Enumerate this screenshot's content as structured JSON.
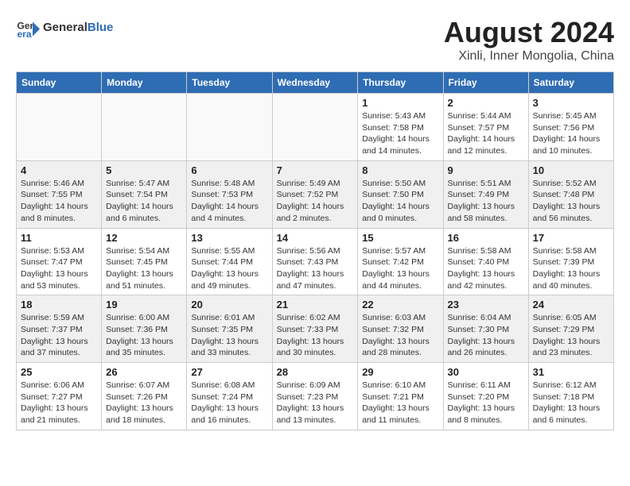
{
  "header": {
    "logo_general": "General",
    "logo_blue": "Blue",
    "month_year": "August 2024",
    "location": "Xinli, Inner Mongolia, China"
  },
  "calendar": {
    "days_of_week": [
      "Sunday",
      "Monday",
      "Tuesday",
      "Wednesday",
      "Thursday",
      "Friday",
      "Saturday"
    ],
    "weeks": [
      {
        "shaded": false,
        "days": [
          {
            "num": "",
            "sunrise": "",
            "sunset": "",
            "daylight": ""
          },
          {
            "num": "",
            "sunrise": "",
            "sunset": "",
            "daylight": ""
          },
          {
            "num": "",
            "sunrise": "",
            "sunset": "",
            "daylight": ""
          },
          {
            "num": "",
            "sunrise": "",
            "sunset": "",
            "daylight": ""
          },
          {
            "num": "1",
            "sunrise": "Sunrise: 5:43 AM",
            "sunset": "Sunset: 7:58 PM",
            "daylight": "Daylight: 14 hours and 14 minutes."
          },
          {
            "num": "2",
            "sunrise": "Sunrise: 5:44 AM",
            "sunset": "Sunset: 7:57 PM",
            "daylight": "Daylight: 14 hours and 12 minutes."
          },
          {
            "num": "3",
            "sunrise": "Sunrise: 5:45 AM",
            "sunset": "Sunset: 7:56 PM",
            "daylight": "Daylight: 14 hours and 10 minutes."
          }
        ]
      },
      {
        "shaded": true,
        "days": [
          {
            "num": "4",
            "sunrise": "Sunrise: 5:46 AM",
            "sunset": "Sunset: 7:55 PM",
            "daylight": "Daylight: 14 hours and 8 minutes."
          },
          {
            "num": "5",
            "sunrise": "Sunrise: 5:47 AM",
            "sunset": "Sunset: 7:54 PM",
            "daylight": "Daylight: 14 hours and 6 minutes."
          },
          {
            "num": "6",
            "sunrise": "Sunrise: 5:48 AM",
            "sunset": "Sunset: 7:53 PM",
            "daylight": "Daylight: 14 hours and 4 minutes."
          },
          {
            "num": "7",
            "sunrise": "Sunrise: 5:49 AM",
            "sunset": "Sunset: 7:52 PM",
            "daylight": "Daylight: 14 hours and 2 minutes."
          },
          {
            "num": "8",
            "sunrise": "Sunrise: 5:50 AM",
            "sunset": "Sunset: 7:50 PM",
            "daylight": "Daylight: 14 hours and 0 minutes."
          },
          {
            "num": "9",
            "sunrise": "Sunrise: 5:51 AM",
            "sunset": "Sunset: 7:49 PM",
            "daylight": "Daylight: 13 hours and 58 minutes."
          },
          {
            "num": "10",
            "sunrise": "Sunrise: 5:52 AM",
            "sunset": "Sunset: 7:48 PM",
            "daylight": "Daylight: 13 hours and 56 minutes."
          }
        ]
      },
      {
        "shaded": false,
        "days": [
          {
            "num": "11",
            "sunrise": "Sunrise: 5:53 AM",
            "sunset": "Sunset: 7:47 PM",
            "daylight": "Daylight: 13 hours and 53 minutes."
          },
          {
            "num": "12",
            "sunrise": "Sunrise: 5:54 AM",
            "sunset": "Sunset: 7:45 PM",
            "daylight": "Daylight: 13 hours and 51 minutes."
          },
          {
            "num": "13",
            "sunrise": "Sunrise: 5:55 AM",
            "sunset": "Sunset: 7:44 PM",
            "daylight": "Daylight: 13 hours and 49 minutes."
          },
          {
            "num": "14",
            "sunrise": "Sunrise: 5:56 AM",
            "sunset": "Sunset: 7:43 PM",
            "daylight": "Daylight: 13 hours and 47 minutes."
          },
          {
            "num": "15",
            "sunrise": "Sunrise: 5:57 AM",
            "sunset": "Sunset: 7:42 PM",
            "daylight": "Daylight: 13 hours and 44 minutes."
          },
          {
            "num": "16",
            "sunrise": "Sunrise: 5:58 AM",
            "sunset": "Sunset: 7:40 PM",
            "daylight": "Daylight: 13 hours and 42 minutes."
          },
          {
            "num": "17",
            "sunrise": "Sunrise: 5:58 AM",
            "sunset": "Sunset: 7:39 PM",
            "daylight": "Daylight: 13 hours and 40 minutes."
          }
        ]
      },
      {
        "shaded": true,
        "days": [
          {
            "num": "18",
            "sunrise": "Sunrise: 5:59 AM",
            "sunset": "Sunset: 7:37 PM",
            "daylight": "Daylight: 13 hours and 37 minutes."
          },
          {
            "num": "19",
            "sunrise": "Sunrise: 6:00 AM",
            "sunset": "Sunset: 7:36 PM",
            "daylight": "Daylight: 13 hours and 35 minutes."
          },
          {
            "num": "20",
            "sunrise": "Sunrise: 6:01 AM",
            "sunset": "Sunset: 7:35 PM",
            "daylight": "Daylight: 13 hours and 33 minutes."
          },
          {
            "num": "21",
            "sunrise": "Sunrise: 6:02 AM",
            "sunset": "Sunset: 7:33 PM",
            "daylight": "Daylight: 13 hours and 30 minutes."
          },
          {
            "num": "22",
            "sunrise": "Sunrise: 6:03 AM",
            "sunset": "Sunset: 7:32 PM",
            "daylight": "Daylight: 13 hours and 28 minutes."
          },
          {
            "num": "23",
            "sunrise": "Sunrise: 6:04 AM",
            "sunset": "Sunset: 7:30 PM",
            "daylight": "Daylight: 13 hours and 26 minutes."
          },
          {
            "num": "24",
            "sunrise": "Sunrise: 6:05 AM",
            "sunset": "Sunset: 7:29 PM",
            "daylight": "Daylight: 13 hours and 23 minutes."
          }
        ]
      },
      {
        "shaded": false,
        "days": [
          {
            "num": "25",
            "sunrise": "Sunrise: 6:06 AM",
            "sunset": "Sunset: 7:27 PM",
            "daylight": "Daylight: 13 hours and 21 minutes."
          },
          {
            "num": "26",
            "sunrise": "Sunrise: 6:07 AM",
            "sunset": "Sunset: 7:26 PM",
            "daylight": "Daylight: 13 hours and 18 minutes."
          },
          {
            "num": "27",
            "sunrise": "Sunrise: 6:08 AM",
            "sunset": "Sunset: 7:24 PM",
            "daylight": "Daylight: 13 hours and 16 minutes."
          },
          {
            "num": "28",
            "sunrise": "Sunrise: 6:09 AM",
            "sunset": "Sunset: 7:23 PM",
            "daylight": "Daylight: 13 hours and 13 minutes."
          },
          {
            "num": "29",
            "sunrise": "Sunrise: 6:10 AM",
            "sunset": "Sunset: 7:21 PM",
            "daylight": "Daylight: 13 hours and 11 minutes."
          },
          {
            "num": "30",
            "sunrise": "Sunrise: 6:11 AM",
            "sunset": "Sunset: 7:20 PM",
            "daylight": "Daylight: 13 hours and 8 minutes."
          },
          {
            "num": "31",
            "sunrise": "Sunrise: 6:12 AM",
            "sunset": "Sunset: 7:18 PM",
            "daylight": "Daylight: 13 hours and 6 minutes."
          }
        ]
      }
    ]
  }
}
